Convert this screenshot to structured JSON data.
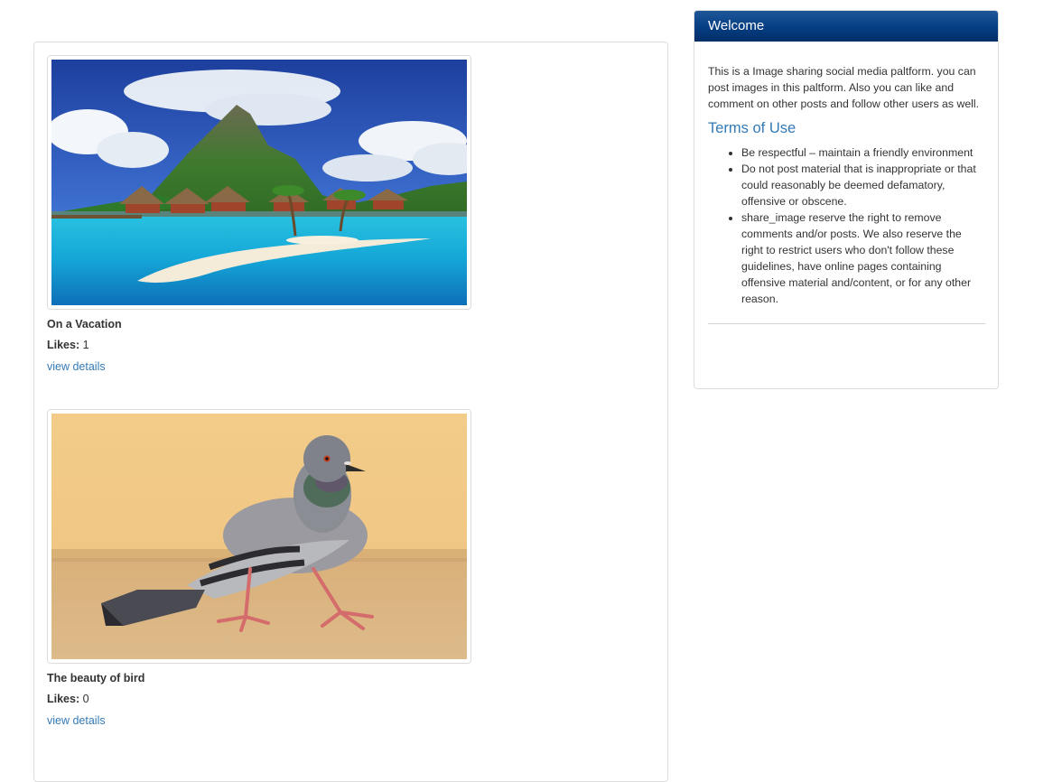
{
  "posts": [
    {
      "title": "On a Vacation",
      "likes_label": "Likes:",
      "likes_count": "1",
      "link_label": "view details",
      "image_icon": "tropical-island-photo"
    },
    {
      "title": "The beauty of bird",
      "likes_label": "Likes:",
      "likes_count": "0",
      "link_label": "view details",
      "image_icon": "pigeon-photo"
    }
  ],
  "sidebar": {
    "heading": "Welcome",
    "intro": "This is a Image sharing social media paltform. you can post images in this paltform. Also you can like and comment on other posts and follow other users as well.",
    "terms_title": "Terms of Use",
    "terms": [
      "Be respectful – maintain a friendly environment",
      "Do not post material that is inappropriate or that could reasonably be deemed defamatory, offensive or obscene.",
      "share_image reserve the right to remove comments and/or posts. We also reserve the right to restrict users who don't follow these guidelines, have online pages containing offensive material and/content, or for any other reason."
    ]
  },
  "colors": {
    "link": "#337ab7",
    "heading_bg": "#063e84",
    "border": "#dddddd"
  }
}
